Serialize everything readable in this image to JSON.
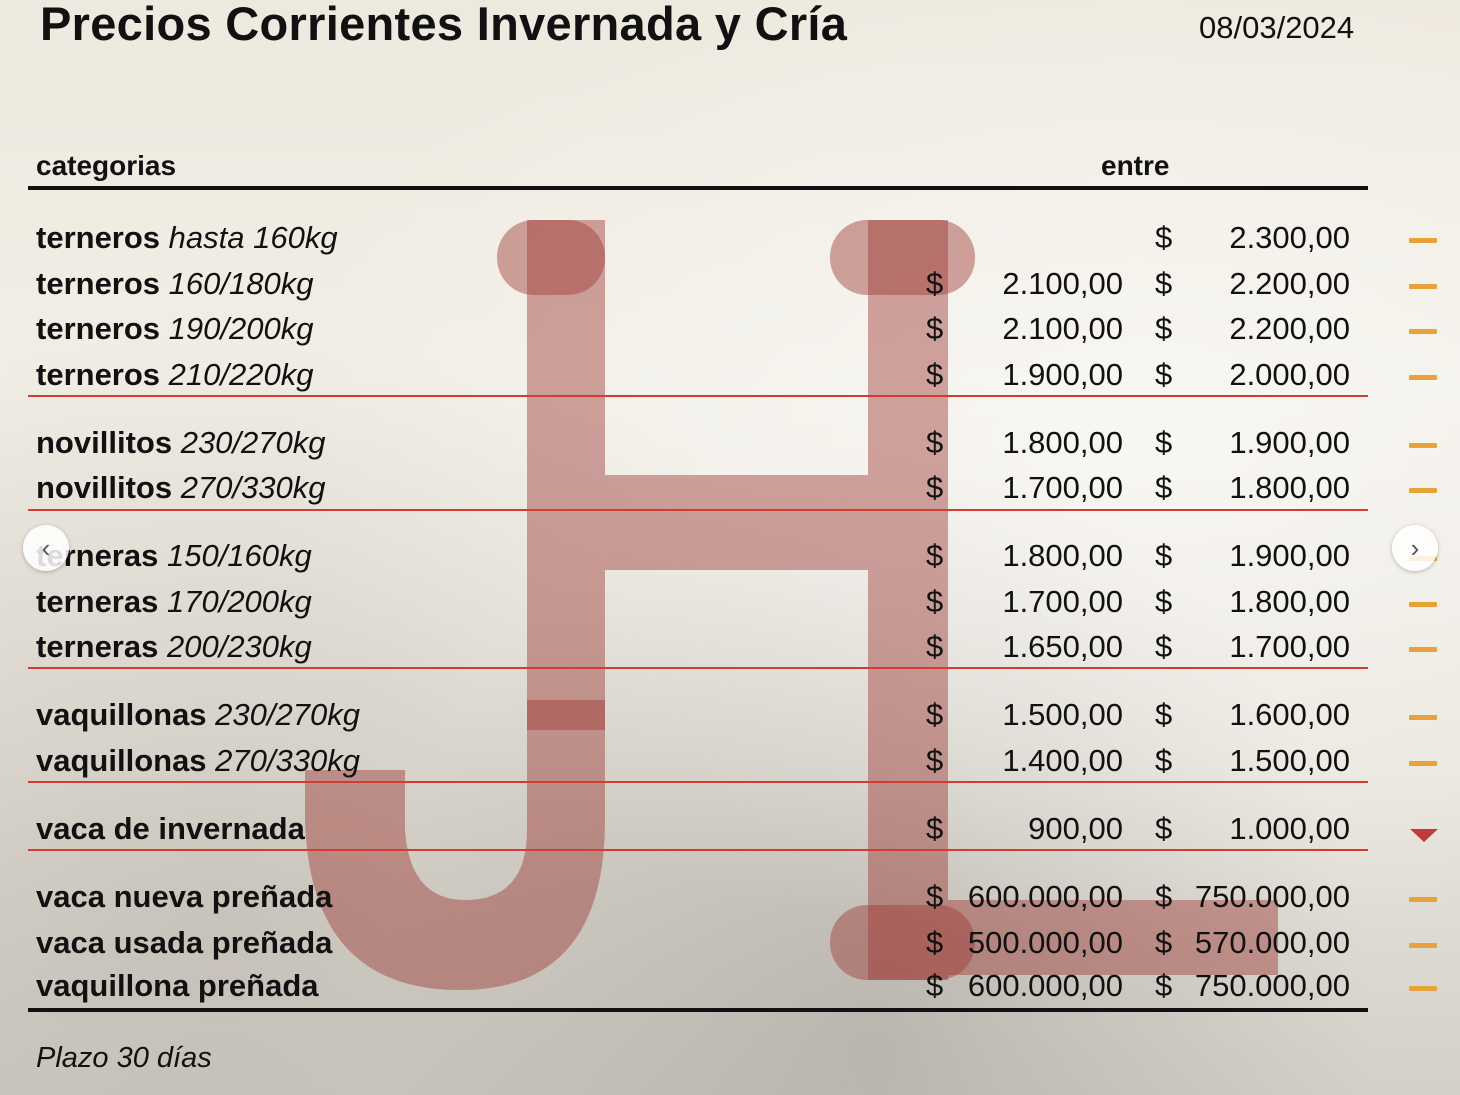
{
  "title": "Precios Corrientes Invernada y Cría",
  "date": "08/03/2024",
  "headers": {
    "category": "categorias",
    "range": "entre"
  },
  "currency": "$",
  "rows": [
    {
      "bold": "terneros",
      "italic": "hasta 160kg",
      "min": "",
      "max": "2.300,00",
      "trend": "stable"
    },
    {
      "bold": "terneros",
      "italic": "160/180kg",
      "min": "2.100,00",
      "max": "2.200,00",
      "trend": "stable"
    },
    {
      "bold": "terneros",
      "italic": "190/200kg",
      "min": "2.100,00",
      "max": "2.200,00",
      "trend": "stable"
    },
    {
      "bold": "terneros",
      "italic": "210/220kg",
      "min": "1.900,00",
      "max": "2.000,00",
      "trend": "stable"
    },
    {
      "bold": "novillitos",
      "italic": "230/270kg",
      "min": "1.800,00",
      "max": "1.900,00",
      "trend": "stable"
    },
    {
      "bold": "novillitos",
      "italic": "270/330kg",
      "min": "1.700,00",
      "max": "1.800,00",
      "trend": "stable"
    },
    {
      "bold": "terneras",
      "italic": "150/160kg",
      "min": "1.800,00",
      "max": "1.900,00",
      "trend": "stable"
    },
    {
      "bold": "terneras",
      "italic": "170/200kg",
      "min": "1.700,00",
      "max": "1.800,00",
      "trend": "stable"
    },
    {
      "bold": "terneras",
      "italic": "200/230kg",
      "min": "1.650,00",
      "max": "1.700,00",
      "trend": "stable"
    },
    {
      "bold": "vaquillonas",
      "italic": "230/270kg",
      "min": "1.500,00",
      "max": "1.600,00",
      "trend": "stable"
    },
    {
      "bold": "vaquillonas",
      "italic": "270/330kg",
      "min": "1.400,00",
      "max": "1.500,00",
      "trend": "stable"
    },
    {
      "bold": "vaca de invernada",
      "italic": "",
      "min": "900,00",
      "max": "1.000,00",
      "trend": "down"
    },
    {
      "bold": "vaca nueva preñada",
      "italic": "",
      "min": "600.000,00",
      "max": "750.000,00",
      "trend": "stable"
    },
    {
      "bold": "vaca usada preñada",
      "italic": "",
      "min": "500.000,00",
      "max": "570.000,00",
      "trend": "stable"
    },
    {
      "bold": "vaquillona preñada",
      "italic": "",
      "min": "600.000,00",
      "max": "750.000,00",
      "trend": "stable"
    }
  ],
  "footer": "Plazo 30 días",
  "nav": {
    "prev": "‹",
    "next": "›"
  },
  "colors": {
    "separator": "#d43c32",
    "stable": "#e8a23a",
    "down": "#c0393b",
    "logo": "#9e3a36"
  }
}
